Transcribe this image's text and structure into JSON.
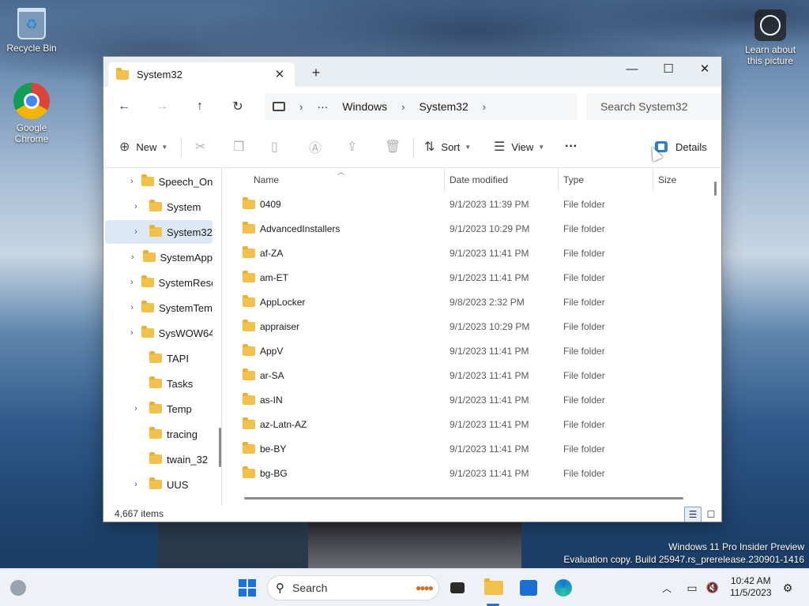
{
  "desktop": {
    "icons": [
      {
        "label": "Recycle Bin",
        "icon": "recycle-bin-icon"
      },
      {
        "label": "Google Chrome",
        "icon": "chrome-icon"
      },
      {
        "label": "Learn about this picture",
        "icon": "learn-about-picture-icon"
      }
    ],
    "watermark": {
      "line1": "Windows 11 Pro Insider Preview",
      "line2": "Evaluation copy. Build 25947.rs_prerelease.230901-1416"
    }
  },
  "window": {
    "tab_title": "System32",
    "tab_close_glyph": "✕",
    "new_tab_glyph": "+",
    "controls": {
      "minimize": "—",
      "maximize": "☐",
      "close": "✕"
    },
    "nav": {
      "back": "←",
      "forward": "→",
      "up": "↑",
      "refresh": "↻"
    },
    "breadcrumb": {
      "more": "···",
      "items": [
        "Windows",
        "System32"
      ],
      "separator": "›"
    },
    "search_placeholder": "Search System32",
    "commands": {
      "new_label": "New",
      "sort_label": "Sort",
      "view_label": "View",
      "more_glyph": "···",
      "details_label": "Details"
    },
    "sidebar": [
      {
        "label": "Speech_On",
        "chevron": true
      },
      {
        "label": "System",
        "chevron": true
      },
      {
        "label": "System32",
        "chevron": true,
        "selected": true
      },
      {
        "label": "SystemApp",
        "chevron": true
      },
      {
        "label": "SystemReso",
        "chevron": true
      },
      {
        "label": "SystemTem",
        "chevron": true
      },
      {
        "label": "SysWOW64",
        "chevron": true
      },
      {
        "label": "TAPI",
        "chevron": false
      },
      {
        "label": "Tasks",
        "chevron": false
      },
      {
        "label": "Temp",
        "chevron": true
      },
      {
        "label": "tracing",
        "chevron": false
      },
      {
        "label": "twain_32",
        "chevron": false
      },
      {
        "label": "UUS",
        "chevron": true
      }
    ],
    "columns": {
      "name": "Name",
      "date": "Date modified",
      "type": "Type",
      "size": "Size"
    },
    "files": [
      {
        "name": "0409",
        "date": "9/1/2023 11:39 PM",
        "type": "File folder"
      },
      {
        "name": "AdvancedInstallers",
        "date": "9/1/2023 10:29 PM",
        "type": "File folder"
      },
      {
        "name": "af-ZA",
        "date": "9/1/2023 11:41 PM",
        "type": "File folder"
      },
      {
        "name": "am-ET",
        "date": "9/1/2023 11:41 PM",
        "type": "File folder"
      },
      {
        "name": "AppLocker",
        "date": "9/8/2023 2:32 PM",
        "type": "File folder"
      },
      {
        "name": "appraiser",
        "date": "9/1/2023 10:29 PM",
        "type": "File folder"
      },
      {
        "name": "AppV",
        "date": "9/1/2023 11:41 PM",
        "type": "File folder"
      },
      {
        "name": "ar-SA",
        "date": "9/1/2023 11:41 PM",
        "type": "File folder"
      },
      {
        "name": "as-IN",
        "date": "9/1/2023 11:41 PM",
        "type": "File folder"
      },
      {
        "name": "az-Latn-AZ",
        "date": "9/1/2023 11:41 PM",
        "type": "File folder"
      },
      {
        "name": "be-BY",
        "date": "9/1/2023 11:41 PM",
        "type": "File folder"
      },
      {
        "name": "bg-BG",
        "date": "9/1/2023 11:41 PM",
        "type": "File folder"
      }
    ],
    "status": {
      "item_count": "4,667 items"
    }
  },
  "taskbar": {
    "search_label": "Search",
    "time": "10:42 AM",
    "date": "11/5/2023",
    "tray_chevron": "︿"
  },
  "colors": {
    "accent": "#1a73d9",
    "folder": "#f3c14a",
    "selection": "#dce8f5"
  }
}
